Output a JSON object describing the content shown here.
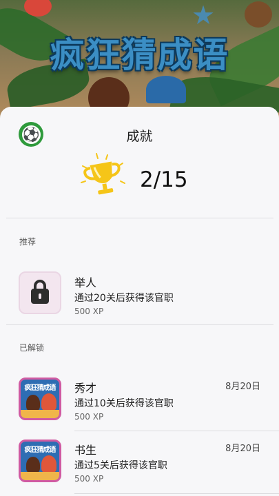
{
  "background": {
    "game_title": "疯狂猜成语"
  },
  "header": {
    "title": "成就",
    "avatar_icon": "soccer-ball-icon",
    "trophy_icon": "trophy-icon",
    "progress": "2/15"
  },
  "sections": {
    "recommended_label": "推荐",
    "unlocked_label": "已解锁"
  },
  "recommended": [
    {
      "name": "举人",
      "desc": "通过20关后获得该官职",
      "xp": "500 XP",
      "icon": "lock-icon"
    }
  ],
  "unlocked": [
    {
      "name": "秀才",
      "desc": "通过10关后获得该官职",
      "xp": "500 XP",
      "date": "8月20日",
      "thumb_title": "疯狂猜成语"
    },
    {
      "name": "书生",
      "desc": "通过5关后获得该官职",
      "xp": "500 XP",
      "date": "8月20日",
      "thumb_title": "疯狂猜成语"
    }
  ],
  "colors": {
    "sheet_bg": "#f7f7f9",
    "trophy": "#f5c518",
    "title_art": "#3b8ec4"
  }
}
